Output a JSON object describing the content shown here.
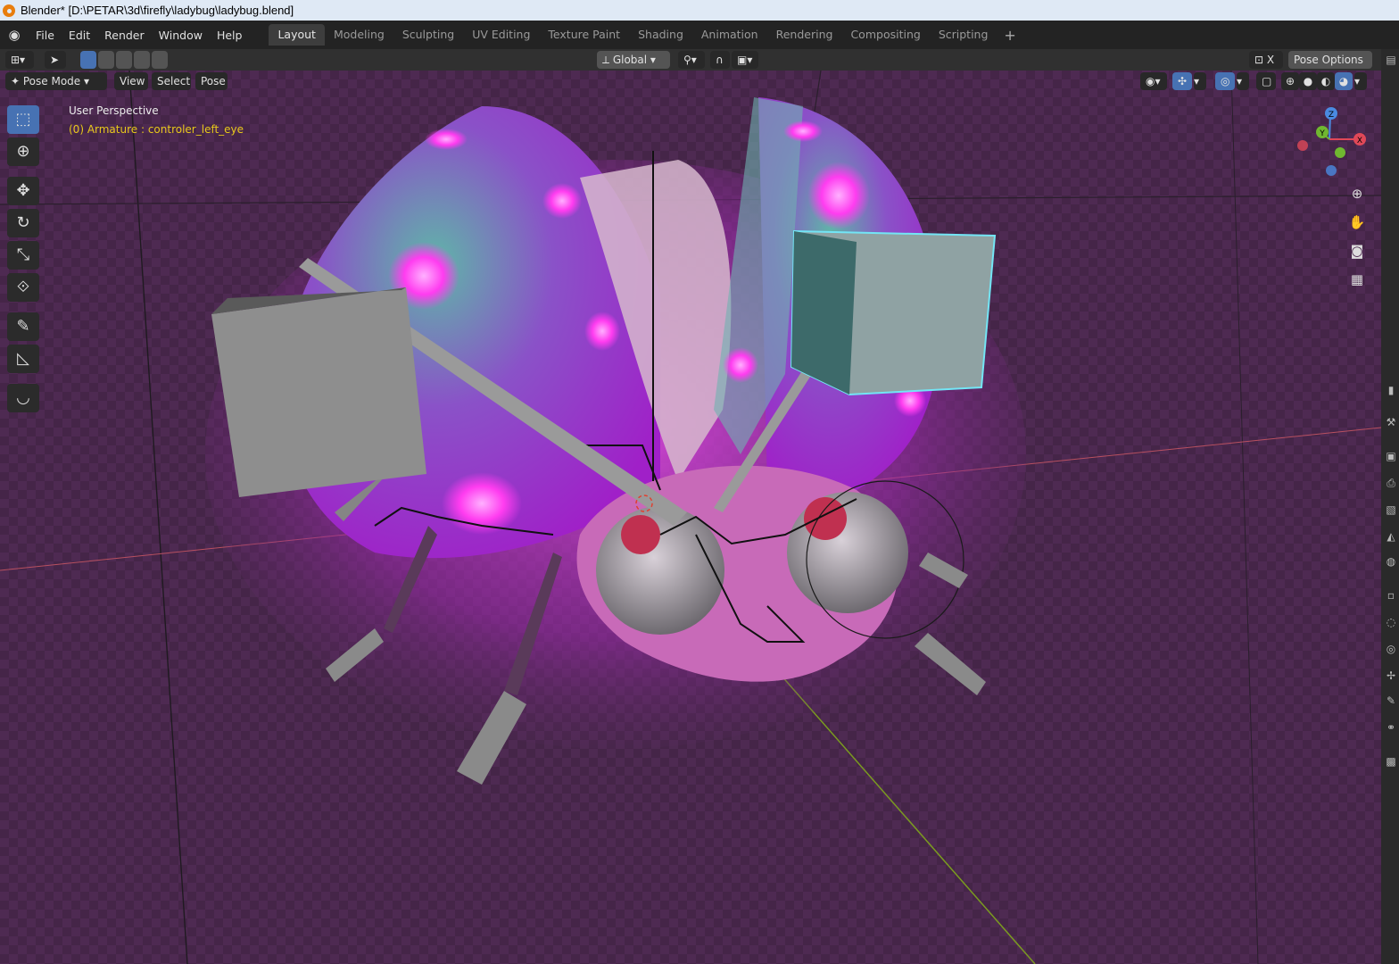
{
  "window": {
    "title": "Blender* [D:\\PETAR\\3d\\firefly\\ladybug\\ladybug.blend]"
  },
  "menu": {
    "items": [
      "File",
      "Edit",
      "Render",
      "Window",
      "Help"
    ]
  },
  "workspaces": {
    "tabs": [
      "Layout",
      "Modeling",
      "Sculpting",
      "UV Editing",
      "Texture Paint",
      "Shading",
      "Animation",
      "Rendering",
      "Compositing",
      "Scripting"
    ],
    "active": "Layout",
    "add_label": "+"
  },
  "header": {
    "orientation": "Global",
    "pose_options": "Pose Options",
    "x_label": "X",
    "mode": "Pose Mode",
    "view": "View",
    "select": "Select",
    "pose": "Pose"
  },
  "viewport": {
    "perspective": "User Perspective",
    "active_object": "(0) Armature : controler_left_eye",
    "gizmo": {
      "x": "X",
      "y": "Y",
      "z": "Z"
    }
  },
  "colors": {
    "accent": "#4772b3",
    "object_text": "#e8c81b",
    "selected_outline": "#73e5f5",
    "magenta_glow": "#ff3cf0"
  },
  "icons": {
    "tools": [
      "select-box-icon",
      "cursor-icon",
      "move-icon",
      "rotate-icon",
      "scale-icon",
      "transform-icon",
      "annotate-icon",
      "measure-icon",
      "relax-icon"
    ],
    "nav": [
      "zoom-icon",
      "pan-hand-icon",
      "camera-icon",
      "grid-ortho-icon"
    ]
  }
}
